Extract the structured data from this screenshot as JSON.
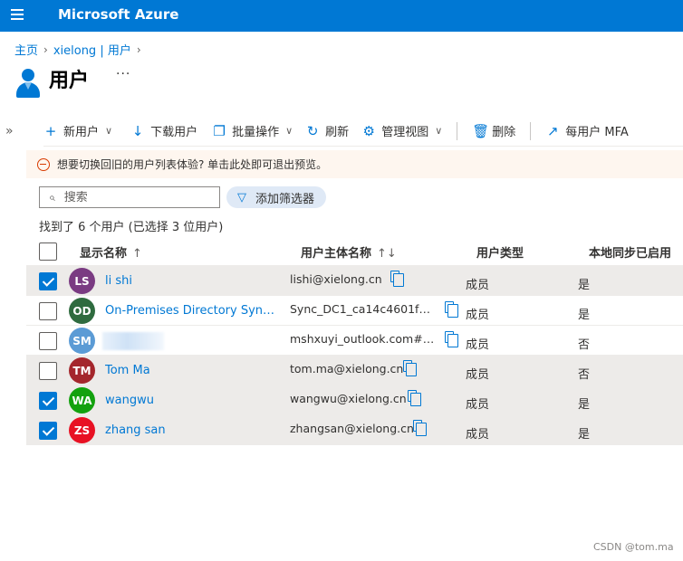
{
  "topbar": {
    "brand": "Microsoft Azure",
    "menu_icon": "hamburger-menu-icon"
  },
  "breadcrumb": {
    "home": "主页",
    "tenant": "xielong | 用户"
  },
  "page": {
    "title": "用户",
    "more": "···",
    "icon": "user-icon"
  },
  "toolbar": {
    "new_user": "新用户",
    "download_users": "下载用户",
    "bulk_operations": "批量操作",
    "refresh": "刷新",
    "manage_view": "管理视图",
    "delete": "删除",
    "per_user_mfa": "每用户 MFA"
  },
  "banner": {
    "text": "想要切换回旧的用户列表体验? 单击此处即可退出预览。"
  },
  "search": {
    "placeholder": "搜索",
    "value": ""
  },
  "filter": {
    "label": "添加筛选器"
  },
  "summary": "找到了 6 个用户 (已选择 3 位用户)",
  "table": {
    "columns": {
      "display_name": "显示名称",
      "display_name_sort": "↑",
      "upn": "用户主体名称",
      "upn_sort": "↑↓",
      "user_type": "用户类型",
      "sync": "本地同步已启用"
    },
    "rows": [
      {
        "initials": "LS",
        "color": "#7a3b82",
        "name": "li shi",
        "upn": "lishi@xielong.cn",
        "type": "成员",
        "sync": "是",
        "selected": true
      },
      {
        "initials": "OD",
        "color": "#2f6b3f",
        "name": "On-Premises Directory Synchro...",
        "upn": "Sync_DC1_ca14c4601fbc...",
        "type": "成员",
        "sync": "是",
        "selected": false
      },
      {
        "initials": "SM",
        "color": "#5b9bd5",
        "name": "",
        "upn": "mshxuyi_outlook.com#EX...",
        "type": "成员",
        "sync": "否",
        "selected": false
      },
      {
        "initials": "TM",
        "color": "#a4262c",
        "name": "Tom Ma",
        "upn": "tom.ma@xielong.cn",
        "type": "成员",
        "sync": "否",
        "selected": false
      },
      {
        "initials": "WA",
        "color": "#13a10e",
        "name": "wangwu",
        "upn": "wangwu@xielong.cn",
        "type": "成员",
        "sync": "是",
        "selected": true
      },
      {
        "initials": "ZS",
        "color": "#e81123",
        "name": "zhang san",
        "upn": "zhangsan@xielong.cn",
        "type": "成员",
        "sync": "是",
        "selected": true
      }
    ]
  },
  "watermark": "CSDN @tom.ma"
}
